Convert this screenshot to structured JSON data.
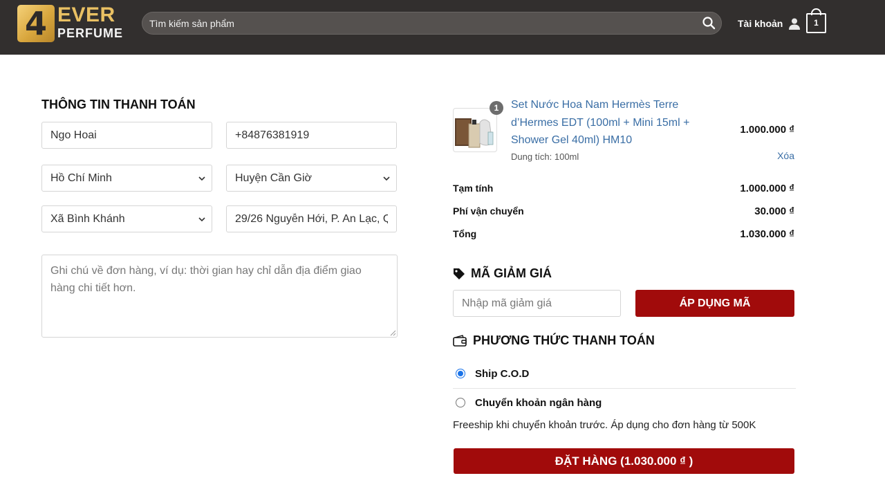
{
  "header": {
    "logo_number": "4",
    "logo_line1": "EVER",
    "logo_line2": "PERFUME",
    "search_placeholder": "Tìm kiếm sản phẩm",
    "account_label": "Tài khoản",
    "cart_count": "1"
  },
  "billing": {
    "title": "THÔNG TIN THANH TOÁN",
    "name": "Ngo Hoai",
    "phone": "+84876381919",
    "province": "Hồ Chí Minh",
    "district": "Huyện Cần Giờ",
    "ward": "Xã Bình Khánh",
    "address": "29/26 Nguyễn Hới, P. An Lạc, Q",
    "notes_placeholder": "Ghi chú về đơn hàng, ví dụ: thời gian hay chỉ dẫn địa điểm giao hàng chi tiết hơn."
  },
  "cart": {
    "items": [
      {
        "quantity": "1",
        "name": "Set Nước Hoa Nam Hermès Terre d’Hermes EDT (100ml + Mini 15ml + Shower Gel 40ml) HM10",
        "variant": "Dung tích: 100ml",
        "price": "1.000.000 ₫",
        "remove_label": "Xóa"
      }
    ],
    "subtotal_label": "Tạm tính",
    "subtotal": "1.000.000 ₫",
    "shipping_label": "Phí vận chuyển",
    "shipping": "30.000 ₫",
    "total_label": "Tổng",
    "total": "1.030.000 ₫"
  },
  "coupon": {
    "title": "MÃ GIẢM GIÁ",
    "placeholder": "Nhập mã giảm giá",
    "apply_label": "ÁP DỤNG MÃ"
  },
  "payment": {
    "title": "PHƯƠNG THỨC THANH TOÁN",
    "options": [
      {
        "label": "Ship C.O.D",
        "selected": true
      },
      {
        "label": "Chuyển khoản ngân hàng",
        "selected": false
      }
    ],
    "note": "Freeship khi chuyển khoản trước. Áp dụng cho đơn hàng từ 500K",
    "order_button": "ĐẶT HÀNG (1.030.000 ₫ )"
  },
  "colors": {
    "header_bg": "#322f2e",
    "brand_gold": "#e9c063",
    "accent_red": "#a10b0b",
    "link_blue": "#3a6ea5"
  }
}
